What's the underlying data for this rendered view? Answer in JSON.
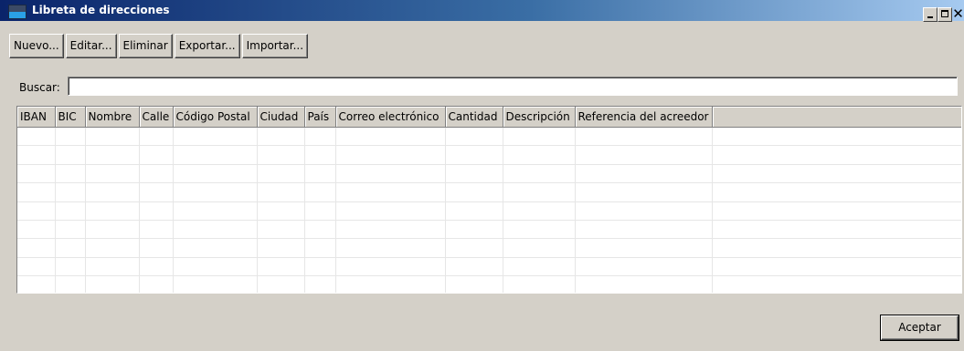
{
  "window": {
    "title": "Libreta de direcciones",
    "controls": {
      "minimize_icon": "minimize-icon",
      "maximize_icon": "maximize-icon",
      "close_icon": "close-icon",
      "close_glyph": "✕"
    }
  },
  "toolbar": {
    "new_label": "Nuevo...",
    "edit_label": "Editar...",
    "delete_label": "Eliminar",
    "export_label": "Exportar...",
    "import_label": "Importar..."
  },
  "search": {
    "label": "Buscar:",
    "value": ""
  },
  "table": {
    "columns": [
      "IBAN",
      "BIC",
      "Nombre",
      "Calle",
      "Código Postal",
      "Ciudad",
      "País",
      "Correo electrónico",
      "Cantidad",
      "Descripción",
      "Referencia del acreedor"
    ],
    "rows": []
  },
  "footer": {
    "accept_label": "Aceptar"
  },
  "colors": {
    "window_bg": "#d4d0c8",
    "titlebar_start": "#0a246a",
    "titlebar_end": "#a6caf0"
  }
}
